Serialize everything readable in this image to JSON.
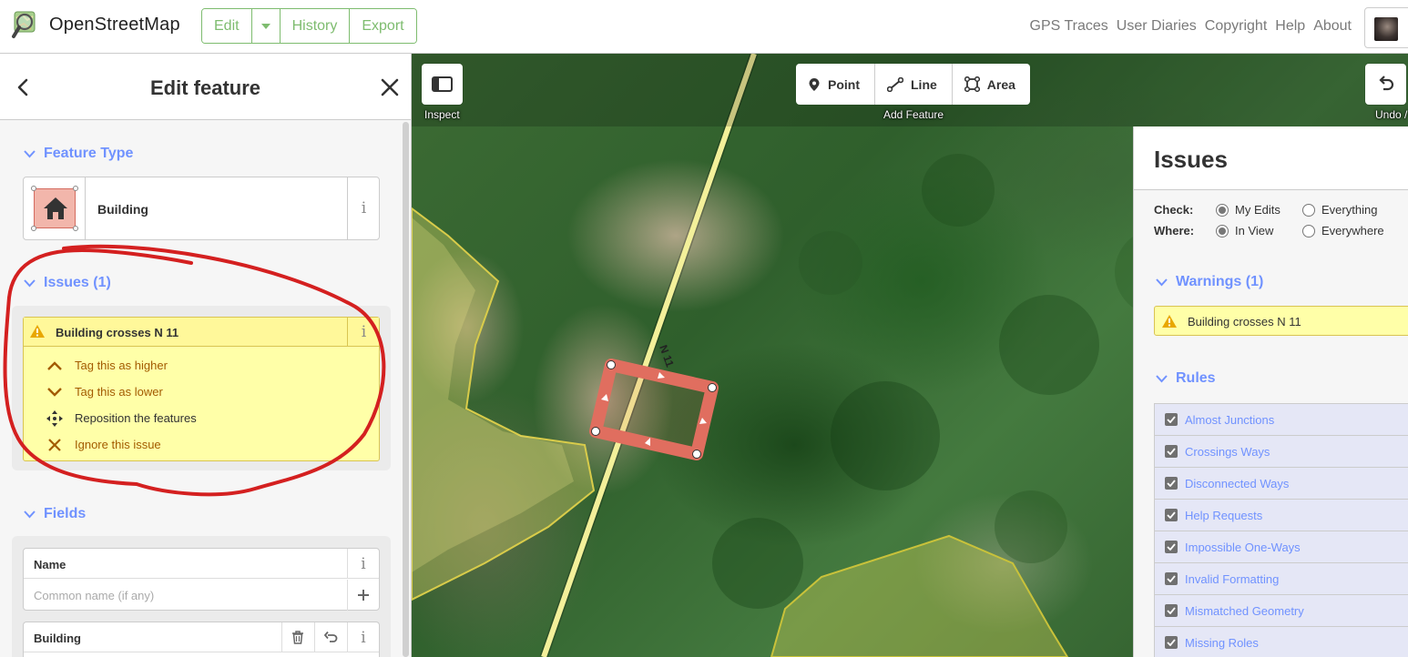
{
  "topbar": {
    "app_name": "OpenStreetMap",
    "edit_label": "Edit",
    "history_label": "History",
    "export_label": "Export",
    "nav_links": [
      "GPS Traces",
      "User Diaries",
      "Copyright",
      "Help",
      "About"
    ]
  },
  "sidebar": {
    "title": "Edit feature",
    "feature_type": {
      "section_label": "Feature Type",
      "preset_name": "Building",
      "info_label": "i"
    },
    "issues": {
      "section_label": "Issues (1)",
      "issue_title": "Building crosses N 11",
      "info_label": "i",
      "fixes": [
        {
          "label": "Tag this as higher",
          "icon": "chevron-up-icon"
        },
        {
          "label": "Tag this as lower",
          "icon": "chevron-down-icon"
        },
        {
          "label": "Reposition the features",
          "icon": "move-icon"
        },
        {
          "label": "Ignore this issue",
          "icon": "close-icon"
        }
      ]
    },
    "fields": {
      "section_label": "Fields",
      "name_field": {
        "label": "Name",
        "placeholder": "Common name (if any)",
        "info_label": "i"
      },
      "building_field": {
        "label": "Building",
        "info_label": "i"
      }
    }
  },
  "map": {
    "inspect_label": "Inspect",
    "add_feature_label": "Add Feature",
    "modes": [
      {
        "label": "Point",
        "icon": "point-icon"
      },
      {
        "label": "Line",
        "icon": "line-icon"
      },
      {
        "label": "Area",
        "icon": "area-icon"
      }
    ],
    "undo_label": "Undo /",
    "road_label": "N 11"
  },
  "issues_pane": {
    "title": "Issues",
    "check_label": "Check:",
    "where_label": "Where:",
    "check_options": [
      {
        "label": "My Edits",
        "selected": true
      },
      {
        "label": "Everything",
        "selected": false
      }
    ],
    "where_options": [
      {
        "label": "In View",
        "selected": true
      },
      {
        "label": "Everywhere",
        "selected": false
      }
    ],
    "warnings_label": "Warnings (1)",
    "warning_item": "Building crosses N 11",
    "rules_label": "Rules",
    "rules": [
      "Almost Junctions",
      "Crossings Ways",
      "Disconnected Ways",
      "Help Requests",
      "Impossible One-Ways",
      "Invalid Formatting",
      "Mismatched Geometry",
      "Missing Roles"
    ]
  },
  "colors": {
    "osm_green": "#7ebc6f",
    "link_blue": "#7092ff",
    "warning_fill": "#ffffa8",
    "fix_text": "#a35b00",
    "annotation_red": "#d42020",
    "building_red": "#e06e5f",
    "road_yellow": "#f3f09a"
  }
}
